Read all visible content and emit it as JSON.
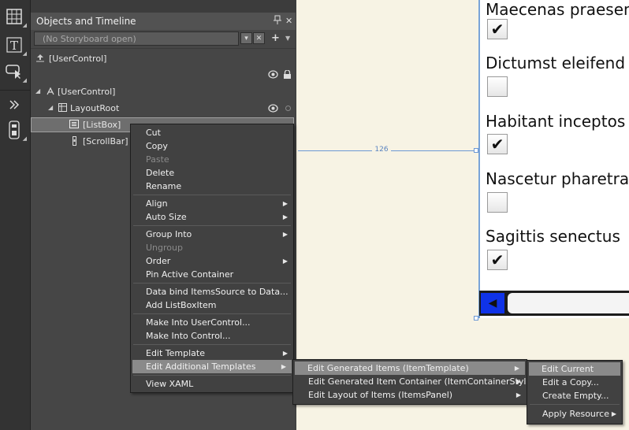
{
  "panel": {
    "title": "Objects and Timeline",
    "storyboard_placeholder": "(No Storyboard open)"
  },
  "tree": {
    "root_label": "[UserControl]",
    "items": [
      {
        "label": "[UserControl]"
      },
      {
        "label": "LayoutRoot"
      },
      {
        "label": "[ListBox]"
      },
      {
        "label": "[ScrollBar]"
      }
    ]
  },
  "artboard": {
    "items": [
      {
        "text": "Maecenas praesent",
        "checked": true
      },
      {
        "text": "Dictumst eleifend",
        "checked": false
      },
      {
        "text": "Habitant inceptos",
        "checked": true
      },
      {
        "text": "Nascetur pharetra",
        "checked": false
      },
      {
        "text": "Sagittis senectus",
        "checked": true
      }
    ],
    "measure_label": "126",
    "check_glyph": "✔"
  },
  "context_menu": {
    "items": [
      {
        "label": "Cut"
      },
      {
        "label": "Copy"
      },
      {
        "label": "Paste",
        "disabled": true
      },
      {
        "label": "Delete"
      },
      {
        "label": "Rename"
      },
      {
        "label": "Align"
      },
      {
        "label": "Auto Size"
      },
      {
        "label": "Group Into"
      },
      {
        "label": "Ungroup",
        "disabled": true
      },
      {
        "label": "Order"
      },
      {
        "label": "Pin Active Container"
      },
      {
        "label": "Data bind ItemsSource to Data..."
      },
      {
        "label": "Add ListBoxItem"
      },
      {
        "label": "Make Into UserControl..."
      },
      {
        "label": "Make Into Control..."
      },
      {
        "label": "Edit Template"
      },
      {
        "label": "Edit Additional Templates"
      },
      {
        "label": "View XAML"
      }
    ]
  },
  "submenu_templates": {
    "items": [
      {
        "label": "Edit Generated Items (ItemTemplate)"
      },
      {
        "label": "Edit Generated Item Container (ItemContainerStyle)"
      },
      {
        "label": "Edit Layout of Items (ItemsPanel)"
      }
    ]
  },
  "submenu_edit": {
    "items": [
      {
        "label": "Edit Current"
      },
      {
        "label": "Edit a Copy..."
      },
      {
        "label": "Create Empty..."
      },
      {
        "label": "Apply Resource"
      }
    ]
  },
  "colors": {
    "highlight": "#8a8a8a",
    "scrollbar_button": "#1033e8",
    "artboard_border": "#7aa4d8"
  }
}
